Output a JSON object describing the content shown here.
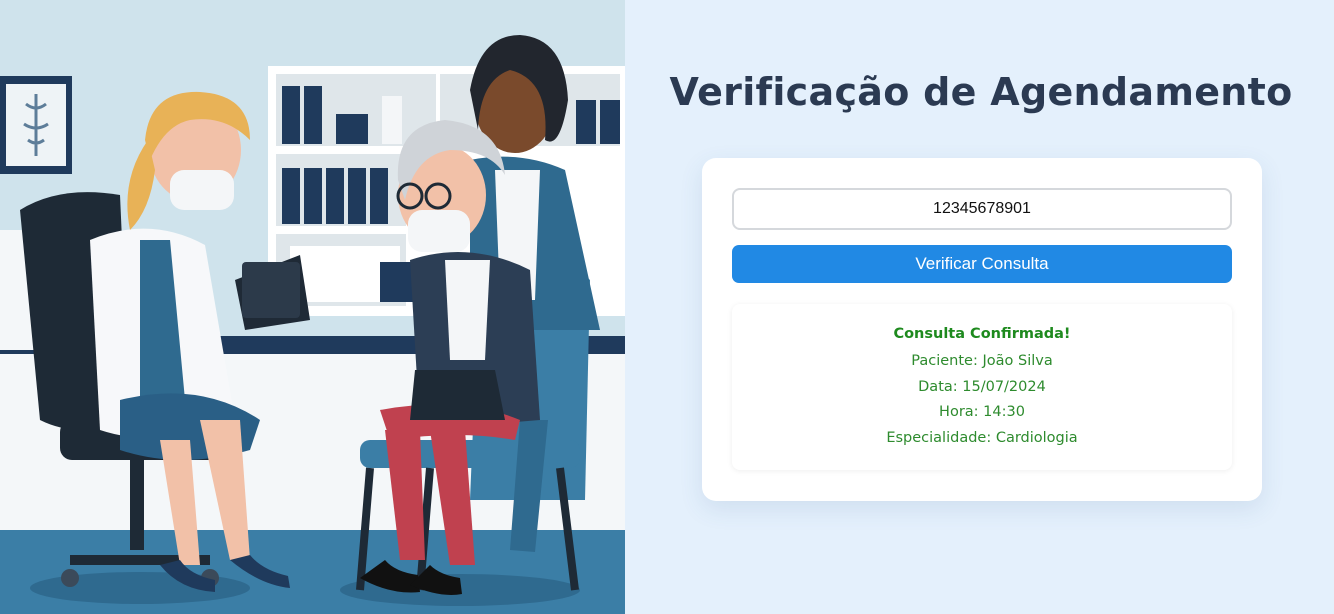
{
  "page": {
    "title": "Verificação de Agendamento"
  },
  "form": {
    "cpf_value": "12345678901",
    "button_label": "Verificar Consulta"
  },
  "result": {
    "status": "Consulta Confirmada!",
    "paciente": "Paciente: João Silva",
    "data": "Data: 15/07/2024",
    "hora": "Hora: 14:30",
    "especialidade": "Especialidade: Cardiologia"
  },
  "colors": {
    "background": "#e4f0fc",
    "title": "#2b3a52",
    "button": "#2189e4",
    "success": "#2e8b2e"
  },
  "illustration": {
    "subject": "doctor-with-tablet-consulting-elderly-patient-and-caregiver"
  }
}
